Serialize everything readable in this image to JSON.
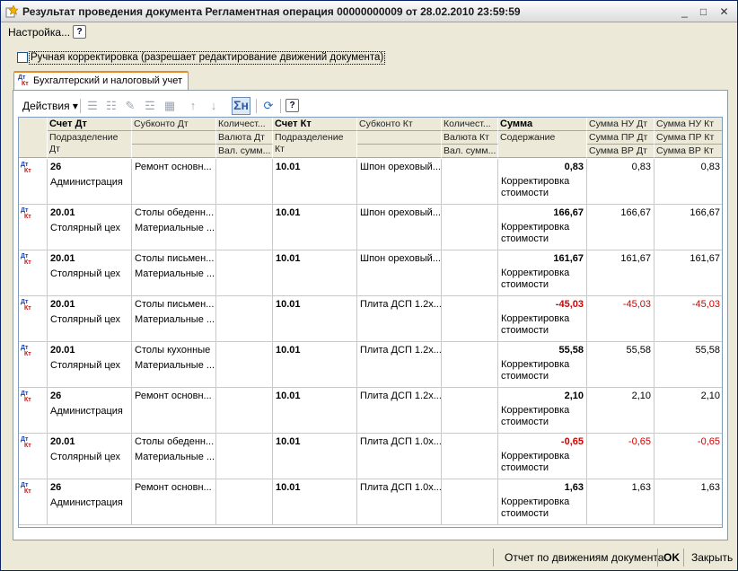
{
  "window": {
    "title": "Результат проведения документа Регламентная операция 00000000009 от 28.02.2010 23:59:59",
    "minimize_glyph": "_",
    "maximize_glyph": "□",
    "close_glyph": "✕"
  },
  "menu": {
    "settings_label": "Настройка...",
    "help_glyph": "?"
  },
  "manual_edit": {
    "label": "Ручная корректировка (разрешает редактирование движений документа)",
    "checked": false
  },
  "tab": {
    "label": "Бухгалтерский и налоговый учет",
    "icon_dt": "Дт",
    "icon_kt": "Кт"
  },
  "toolbar": {
    "actions_label": "Действия",
    "dropdown_glyph": "▾",
    "sigma_glyph": "Σн",
    "help_glyph": "?"
  },
  "table": {
    "headers": {
      "schet_dt": "Счет Дт",
      "podrazd_dt": "Подразделение Дт",
      "subkonto_dt": "Субконто Дт",
      "kol_dt": "Количест...",
      "val_dt": "Валюта Дт",
      "val_summ_dt": "Вал. сумм...",
      "schet_kt": "Счет Кт",
      "podrazd_kt": "Подразделение Кт",
      "subkonto_kt": "Субконто Кт",
      "kol_kt": "Количест...",
      "val_kt": "Валюта Кт",
      "val_summ_kt": "Вал. сумм...",
      "summa": "Сумма",
      "soderzhanie": "Содержание",
      "nu_dt": "Сумма НУ Дт",
      "pr_dt": "Сумма ПР Дт",
      "vr_dt": "Сумма ВР Дт",
      "nu_kt": "Сумма НУ Кт",
      "pr_kt": "Сумма ПР Кт",
      "vr_kt": "Сумма ВР Кт"
    },
    "rows": [
      {
        "schet_dt": "26",
        "podrazd_dt": "Администрация",
        "sub_dt1": "Ремонт основн...",
        "sub_dt2": "",
        "schet_kt": "10.01",
        "sub_kt1": "Шпон ореховый...",
        "summa": "0,83",
        "soderzhanie": "Корректировка стоимости",
        "nu_dt": "0,83",
        "nu_kt": "0,83",
        "negative": false
      },
      {
        "schet_dt": "20.01",
        "podrazd_dt": "Столярный цех",
        "sub_dt1": "Столы обеденн...",
        "sub_dt2": "Материальные ...",
        "schet_kt": "10.01",
        "sub_kt1": "Шпон ореховый...",
        "summa": "166,67",
        "soderzhanie": "Корректировка стоимости",
        "nu_dt": "166,67",
        "nu_kt": "166,67",
        "negative": false
      },
      {
        "schet_dt": "20.01",
        "podrazd_dt": "Столярный цех",
        "sub_dt1": "Столы письмен...",
        "sub_dt2": "Материальные ...",
        "schet_kt": "10.01",
        "sub_kt1": "Шпон ореховый...",
        "summa": "161,67",
        "soderzhanie": "Корректировка стоимости",
        "nu_dt": "161,67",
        "nu_kt": "161,67",
        "negative": false
      },
      {
        "schet_dt": "20.01",
        "podrazd_dt": "Столярный цех",
        "sub_dt1": "Столы письмен...",
        "sub_dt2": "Материальные ...",
        "schet_kt": "10.01",
        "sub_kt1": "Плита ДСП 1.2х...",
        "summa": "-45,03",
        "soderzhanie": "Корректировка стоимости",
        "nu_dt": "-45,03",
        "nu_kt": "-45,03",
        "negative": true
      },
      {
        "schet_dt": "20.01",
        "podrazd_dt": "Столярный цех",
        "sub_dt1": "Столы кухонные",
        "sub_dt2": "Материальные ...",
        "schet_kt": "10.01",
        "sub_kt1": "Плита ДСП 1.2х...",
        "summa": "55,58",
        "soderzhanie": "Корректировка стоимости",
        "nu_dt": "55,58",
        "nu_kt": "55,58",
        "negative": false
      },
      {
        "schet_dt": "26",
        "podrazd_dt": "Администрация",
        "sub_dt1": "Ремонт основн...",
        "sub_dt2": "",
        "schet_kt": "10.01",
        "sub_kt1": "Плита ДСП 1.2х...",
        "summa": "2,10",
        "soderzhanie": "Корректировка стоимости",
        "nu_dt": "2,10",
        "nu_kt": "2,10",
        "negative": false
      },
      {
        "schet_dt": "20.01",
        "podrazd_dt": "Столярный цех",
        "sub_dt1": "Столы обеденн...",
        "sub_dt2": "Материальные ...",
        "schet_kt": "10.01",
        "sub_kt1": "Плита ДСП 1.0х...",
        "summa": "-0,65",
        "soderzhanie": "Корректировка стоимости",
        "nu_dt": "-0,65",
        "nu_kt": "-0,65",
        "negative": true
      },
      {
        "schet_dt": "26",
        "podrazd_dt": "Администрация",
        "sub_dt1": "Ремонт основн...",
        "sub_dt2": "",
        "schet_kt": "10.01",
        "sub_kt1": "Плита ДСП 1.0х...",
        "summa": "1,63",
        "soderzhanie": "Корректировка стоимости",
        "nu_dt": "1,63",
        "nu_kt": "1,63",
        "negative": false
      }
    ]
  },
  "statusbar": {
    "report_label": "Отчет по движениям документа",
    "ok_label": "OK",
    "close_label": "Закрыть"
  },
  "colors": {
    "negative": "#d00000",
    "tab_accent": "#e68b2c",
    "dt_icon": "#1a3fb0",
    "kt_icon": "#c81010"
  }
}
